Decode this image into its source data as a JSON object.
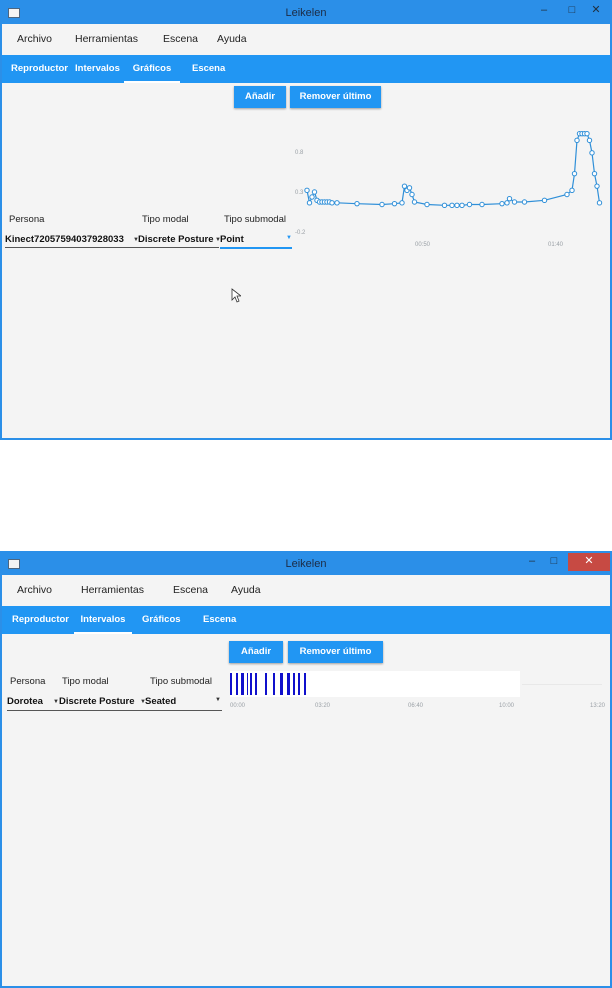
{
  "window1": {
    "title": "Leikelen",
    "menu": [
      "Archivo",
      "Herramientas",
      "Escena",
      "Ayuda"
    ],
    "tabs": [
      "Reproductor",
      "Intervalos",
      "Gráficos",
      "Escena"
    ],
    "active_tab": "Gráficos",
    "buttons": {
      "add": "Añadir",
      "remove": "Remover último"
    },
    "headers": {
      "persona": "Persona",
      "tipo_modal": "Tipo modal",
      "tipo_submodal": "Tipo submodal"
    },
    "values": {
      "persona": "Kinect72057594037928033",
      "tipo_modal": "Discrete Posture",
      "tipo_submodal": "Point"
    }
  },
  "window2": {
    "title": "Leikelen",
    "menu": [
      "Archivo",
      "Herramientas",
      "Escena",
      "Ayuda"
    ],
    "tabs": [
      "Reproductor",
      "Intervalos",
      "Gráficos",
      "Escena"
    ],
    "active_tab": "Intervalos",
    "buttons": {
      "add": "Añadir",
      "remove": "Remover último"
    },
    "headers": {
      "persona": "Persona",
      "tipo_modal": "Tipo modal",
      "tipo_submodal": "Tipo submodal"
    },
    "values": {
      "persona": "Dorotea",
      "tipo_modal": "Discrete Posture",
      "tipo_submodal": "Seated"
    }
  },
  "chart_data": [
    {
      "type": "line",
      "series_color": "#2f8fd8",
      "y_ticks": [
        "0.8",
        "0.3",
        "-0.2"
      ],
      "x_ticks": [
        "00:50",
        "01:40"
      ],
      "ylim": [
        -0.2,
        1.0
      ],
      "xlim": [
        0,
        118
      ],
      "x": [
        0,
        1,
        2,
        3,
        4,
        5,
        6,
        7,
        8,
        9,
        10,
        12,
        20,
        30,
        35,
        38,
        39,
        40,
        41,
        42,
        43,
        48,
        55,
        58,
        60,
        62,
        65,
        70,
        78,
        80,
        81,
        83,
        87,
        95,
        104,
        106,
        107,
        108,
        109,
        110,
        111,
        112,
        113,
        114,
        115,
        116,
        117
      ],
      "y": [
        0.3,
        0.15,
        0.22,
        0.28,
        0.18,
        0.16,
        0.16,
        0.16,
        0.16,
        0.16,
        0.15,
        0.15,
        0.14,
        0.13,
        0.14,
        0.15,
        0.35,
        0.3,
        0.33,
        0.25,
        0.16,
        0.13,
        0.12,
        0.12,
        0.12,
        0.12,
        0.13,
        0.13,
        0.14,
        0.15,
        0.2,
        0.16,
        0.16,
        0.18,
        0.25,
        0.3,
        0.5,
        0.9,
        0.98,
        0.98,
        0.98,
        0.98,
        0.9,
        0.75,
        0.5,
        0.35,
        0.15
      ]
    },
    {
      "type": "timeline",
      "x_ticks": [
        "00:00",
        "03:20",
        "06:40",
        "10:00",
        "13:20"
      ],
      "bar_color": "#1010cc",
      "xlim": [
        0,
        800
      ],
      "intervals": [
        [
          0,
          3
        ],
        [
          7,
          10
        ],
        [
          14,
          17
        ],
        [
          21,
          23
        ],
        [
          25,
          28
        ],
        [
          31,
          34
        ],
        [
          44,
          45
        ],
        [
          54,
          55
        ],
        [
          63,
          66
        ],
        [
          71,
          75
        ],
        [
          79,
          80
        ],
        [
          85,
          88
        ],
        [
          93,
          95
        ]
      ]
    }
  ]
}
